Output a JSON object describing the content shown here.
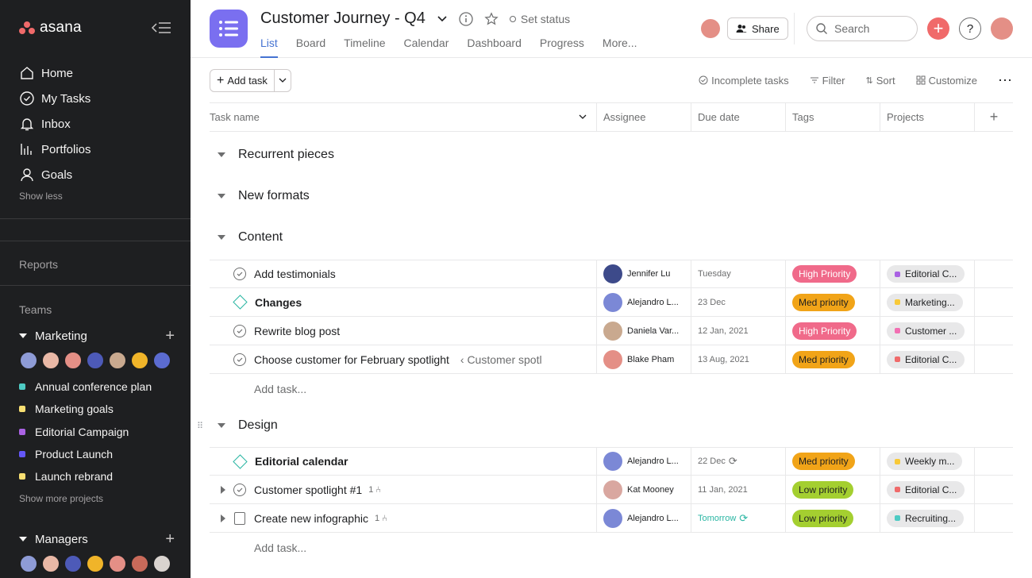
{
  "sidebar": {
    "logo": "asana",
    "nav": [
      {
        "label": "Home",
        "icon": "home-icon"
      },
      {
        "label": "My Tasks",
        "icon": "check-circle-icon"
      },
      {
        "label": "Inbox",
        "icon": "bell-icon"
      },
      {
        "label": "Portfolios",
        "icon": "bar-chart-icon"
      },
      {
        "label": "Goals",
        "icon": "person-icon"
      }
    ],
    "show_less": "Show less",
    "reports": "Reports",
    "teams_heading": "Teams",
    "team1": {
      "name": "Marketing",
      "projects": [
        {
          "name": "Annual conference plan",
          "color": "#4ecbc4"
        },
        {
          "name": "Marketing goals",
          "color": "#f8df72"
        },
        {
          "name": "Editorial Campaign",
          "color": "#aa62e3"
        },
        {
          "name": "Product Launch",
          "color": "#6457f9"
        },
        {
          "name": "Launch rebrand",
          "color": "#f8df72"
        }
      ],
      "show_more": "Show more projects"
    },
    "team2": {
      "name": "Managers"
    }
  },
  "header": {
    "title": "Customer Journey - Q4",
    "set_status": "Set status",
    "tabs": [
      "List",
      "Board",
      "Timeline",
      "Calendar",
      "Dashboard",
      "Progress",
      "More..."
    ],
    "share": "Share",
    "search_placeholder": "Search",
    "help": "?"
  },
  "toolbar": {
    "add_task": "Add task",
    "incomplete": "Incomplete tasks",
    "filter": "Filter",
    "sort": "Sort",
    "customize": "Customize"
  },
  "columns": {
    "task_name": "Task name",
    "assignee": "Assignee",
    "due": "Due date",
    "tags": "Tags",
    "projects": "Projects"
  },
  "sections": [
    {
      "name": "Recurrent pieces"
    },
    {
      "name": "New formats"
    },
    {
      "name": "Content"
    },
    {
      "name": "Design"
    }
  ],
  "content_tasks": [
    {
      "name": "Add testimonials",
      "assignee": "Jennifer Lu",
      "due": "Tuesday",
      "tag": "High Priority",
      "project": "Editorial C...",
      "project_color": "#aa62e3"
    },
    {
      "name": "Changes",
      "assignee": "Alejandro L...",
      "due": "23 Dec",
      "tag": "Med priority",
      "project": "Marketing...",
      "project_color": "#f1bd6c"
    },
    {
      "name": "Rewrite blog post",
      "assignee": "Daniela Var...",
      "due": "12 Jan, 2021",
      "tag": "High Priority",
      "project": "Customer ...",
      "project_color": "#f26fb2"
    },
    {
      "name": "Choose customer for February spotlight",
      "crumb": "‹ Customer spotl",
      "assignee": "Blake Pham",
      "due": "13 Aug, 2021",
      "tag": "Med priority",
      "project": "Editorial C...",
      "project_color": "#f06a6a"
    }
  ],
  "design_tasks": [
    {
      "name": "Editorial calendar",
      "assignee": "Alejandro L...",
      "due": "22 Dec",
      "tag": "Med priority",
      "project": "Weekly m...",
      "project_color": "#f1bd6c"
    },
    {
      "name": "Customer spotlight #1",
      "subtasks": "1",
      "assignee": "Kat Mooney",
      "due": "11 Jan, 2021",
      "tag": "Low priority",
      "project": "Editorial C...",
      "project_color": "#f06a6a"
    },
    {
      "name": "Create new infographic",
      "subtasks": "1",
      "assignee": "Alejandro L...",
      "due": "Tomorrow",
      "tag": "Low priority",
      "project": "Recruiting...",
      "project_color": "#4ecbc4"
    }
  ],
  "add_task_row": "Add task...",
  "colors": {
    "high": "#f06a8a",
    "med": "#f1a418",
    "low": "#a4cf30",
    "accent": "#f06a6a",
    "project_icon": "#7a6ff0"
  }
}
